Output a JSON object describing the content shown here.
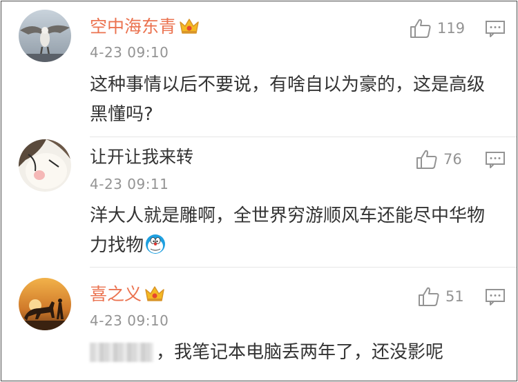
{
  "comments": [
    {
      "username": "空中海东青",
      "vip": true,
      "time": "4-23 09:10",
      "likes": "119",
      "text": "这种事情以后不要说，有啥自以为豪的，这是高级黑懂吗?",
      "avatar_icon": "eagle-avatar"
    },
    {
      "username": "让开让我来转",
      "vip": false,
      "time": "4-23 09:11",
      "likes": "76",
      "text": "洋大人就是雕啊，全世界穷游顺风车还能尽中华物力找物",
      "emoji_icon": "doraemon-emoji",
      "avatar_icon": "cartoon-avatar"
    },
    {
      "username": "喜之义",
      "vip": true,
      "time": "4-23 09:10",
      "likes": "51",
      "text": "，我笔记本电脑丢两年了，还没影呢",
      "avatar_icon": "horse-sunset-avatar"
    }
  ],
  "colors": {
    "vip_name": "#eb7350",
    "normal_name": "#333333",
    "meta_gray": "#939393",
    "crown_gold": "#f5b921"
  },
  "icons": {
    "like": "thumbs-up-icon",
    "reply": "comment-bubble-icon",
    "vip": "crown-icon"
  }
}
